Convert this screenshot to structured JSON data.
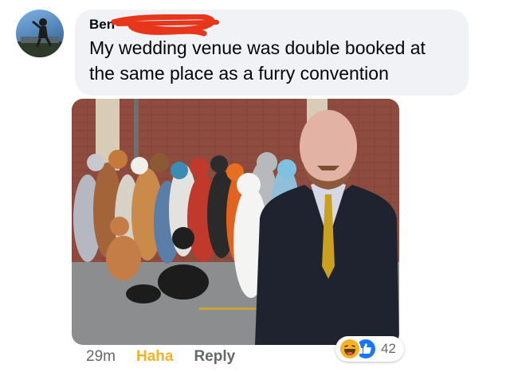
{
  "comment": {
    "author_name": "Ben",
    "text": "My wedding venue was double booked at the same place as a furry convention",
    "timestamp": "29m",
    "haha_label": "Haha",
    "reply_label": "Reply"
  },
  "reactions": {
    "icons": [
      "haha-icon",
      "like-icon"
    ],
    "count": "42"
  },
  "colors": {
    "bubble": "#f0f2f5",
    "haha": "#f7b125",
    "like": "#1877f2",
    "meta_text": "#65676b",
    "redaction": "#e8361d"
  }
}
